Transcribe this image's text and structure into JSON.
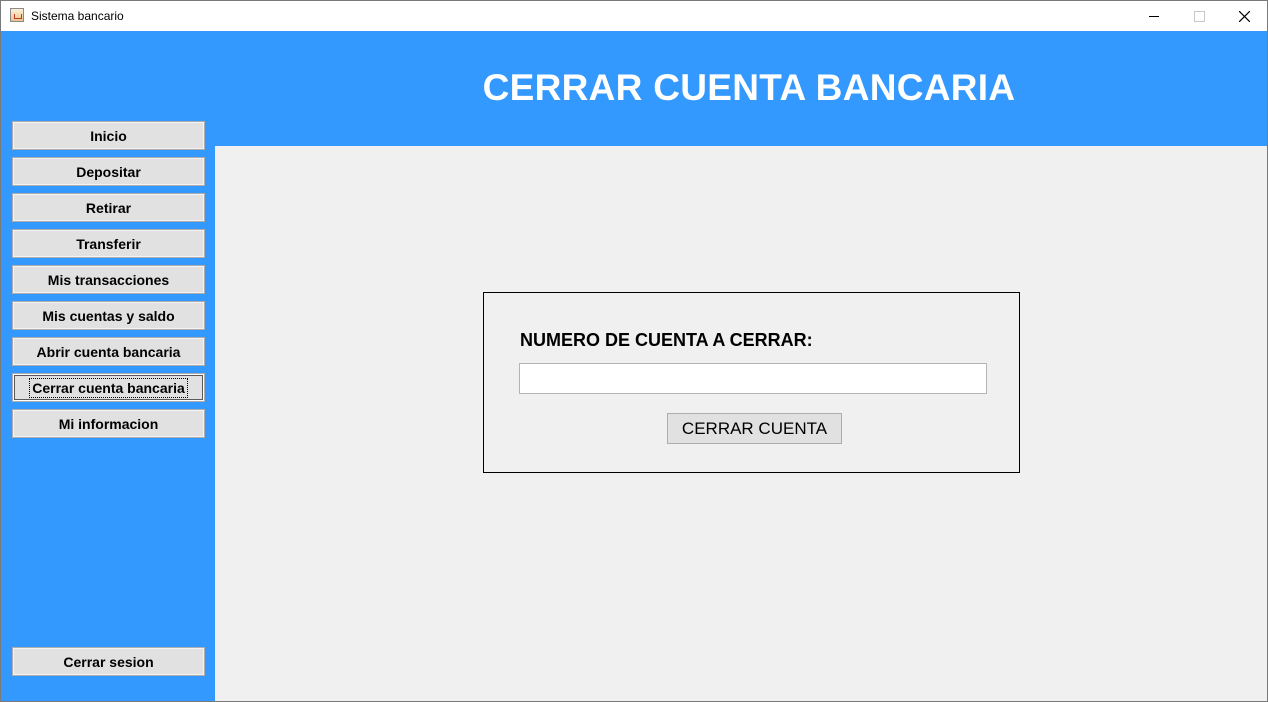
{
  "window": {
    "title": "Sistema bancario",
    "controls": {
      "minimize": "minimize-icon",
      "maximize": "maximize-icon",
      "close": "close-icon"
    }
  },
  "header": {
    "title": "CERRAR CUENTA BANCARIA"
  },
  "sidebar": {
    "items": [
      {
        "label": "Inicio"
      },
      {
        "label": "Depositar"
      },
      {
        "label": "Retirar"
      },
      {
        "label": "Transferir"
      },
      {
        "label": "Mis transacciones"
      },
      {
        "label": "Mis cuentas y saldo"
      },
      {
        "label": "Abrir cuenta bancaria"
      },
      {
        "label": "Cerrar cuenta bancaria",
        "active": true
      },
      {
        "label": "Mi informacion"
      }
    ],
    "logout_label": "Cerrar sesion"
  },
  "form": {
    "account_label": "NUMERO DE CUENTA A CERRAR:",
    "account_value": "",
    "submit_label": "CERRAR CUENTA"
  },
  "colors": {
    "accent": "#3399ff",
    "content_bg": "#f0f0f0",
    "button_bg": "#e1e1e1"
  }
}
